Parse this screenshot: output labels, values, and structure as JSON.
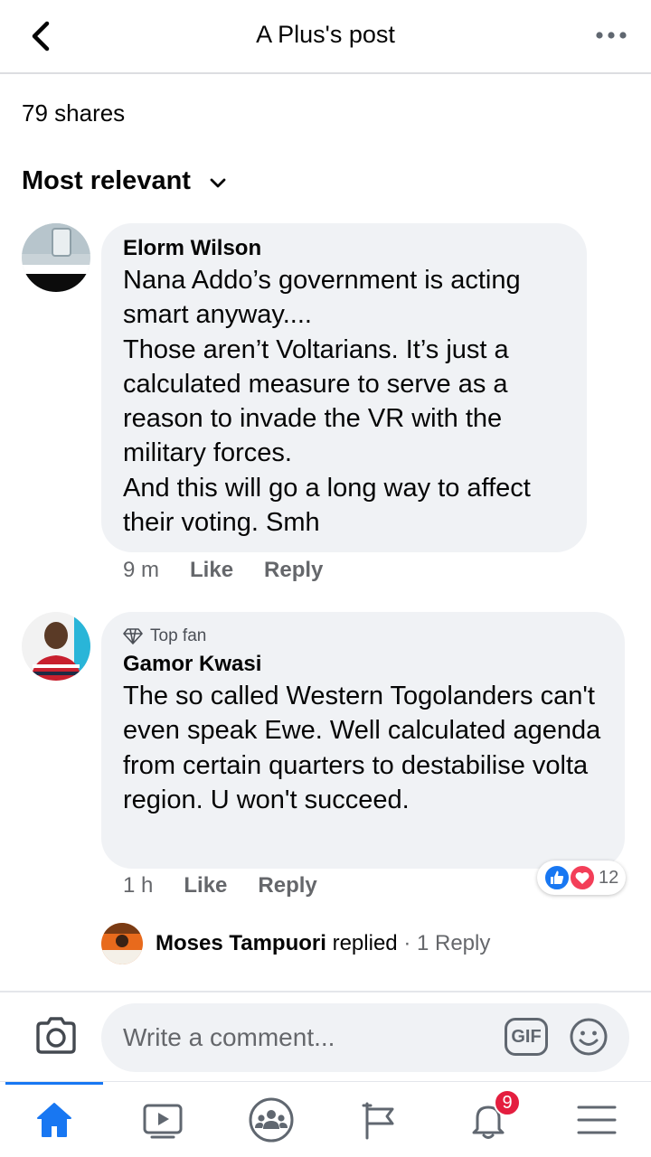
{
  "header": {
    "title": "A Plus's post"
  },
  "post": {
    "shares": "79 shares",
    "sort_label": "Most relevant"
  },
  "comments": [
    {
      "author": "Elorm Wilson",
      "text": "Nana Addo’s government is acting smart anyway....\nThose aren’t Voltarians. It’s just a calculated measure to serve as a reason to invade the VR with the military forces.\nAnd this will go a long way to affect their voting. Smh",
      "time": "9 m",
      "like_label": "Like",
      "reply_label": "Reply"
    },
    {
      "badge": "Top fan",
      "author": "Gamor Kwasi",
      "text": "The so called Western Togolanders can't even speak  Ewe. Well calculated agenda  from certain quarters to destabilise volta region. U won't succeed.",
      "time": "1 h",
      "like_label": "Like",
      "reply_label": "Reply",
      "reaction_count": "12",
      "reply_preview": {
        "name": "Moses Tampuori",
        "action": "replied",
        "meta": "· 1 Reply"
      }
    }
  ],
  "composer": {
    "placeholder": "Write a comment...",
    "gif_label": "GIF"
  },
  "tabs": [
    {
      "icon": "home-icon",
      "active": true
    },
    {
      "icon": "watch-icon"
    },
    {
      "icon": "groups-icon"
    },
    {
      "icon": "pages-flag-icon"
    },
    {
      "icon": "notifications-bell-icon",
      "badge": "9"
    },
    {
      "icon": "menu-icon"
    }
  ],
  "colors": {
    "accent": "#1877f2",
    "bubble": "#f0f2f5",
    "badge": "#e41e3f",
    "secondary_text": "#65676b"
  }
}
